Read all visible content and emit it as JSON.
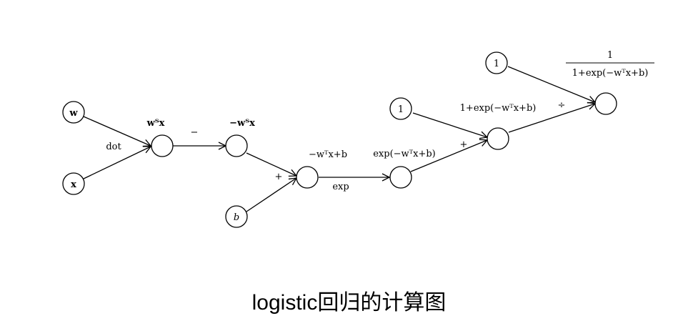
{
  "caption": "logistic回归的计算图",
  "nodes": {
    "w": "w",
    "x": "x",
    "b": "b",
    "one_a": "1",
    "one_b": "1"
  },
  "ops": {
    "dot": "dot",
    "neg": "−",
    "plus1": "+",
    "exp": "exp",
    "plus2": "+",
    "div": "÷"
  },
  "exprs": {
    "wtx": "wᵀx",
    "neg_wtx": "−wᵀx",
    "neg_wtx_b": "−wᵀx+b",
    "exp_term": "exp(−wᵀx+b)",
    "one_plus_exp": "1+exp(−wᵀx+b)",
    "sigmoid_num": "1",
    "sigmoid_den": "1+exp(−wᵀx+b)"
  }
}
